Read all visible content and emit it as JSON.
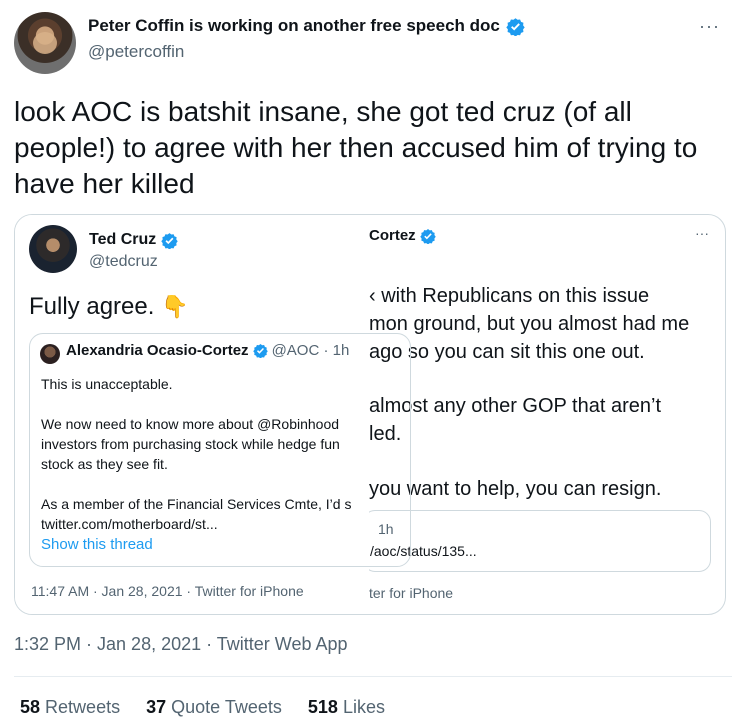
{
  "author": {
    "name": "Peter Coffin is working on another free speech doc",
    "handle": "@petercoffin",
    "more": "···"
  },
  "tweet": {
    "text": "look AOC is batshit insane, she got ted cruz (of all people!) to agree with her then accused him of trying to have her killed",
    "timestamp": "1:32 PM · Jan 28, 2021 · Twitter Web App"
  },
  "screenshot": {
    "cruz": {
      "name": "Ted Cruz",
      "handle": "@tedcruz",
      "text": "Fully agree.",
      "emoji": "👇",
      "time": "11:47 AM · Jan 28, 2021 · Twitter for iPhone"
    },
    "quoted": {
      "name": "Alexandria Ocasio-Cortez",
      "handle_time": "@AOC · 1h",
      "body": "This is unacceptable.\n\nWe now need to know more about @Robinhood\ninvestors from purchasing stock while hedge fun\nstock as they see fit.\n\nAs a member of the Financial Services Cmte, I’d s\ntwitter.com/motherboard/st...",
      "show_thread": "Show this thread"
    },
    "aoc_right": {
      "name_fragment": "Cortez",
      "dots": "···",
      "lines": [
        "‹ with Republicans on this issue",
        "mon ground, but you almost had me",
        "ago so you can sit this one out.",
        "almost any other GOP that aren’t",
        "led.",
        "you want to help, you can resign."
      ],
      "card_time": "1h",
      "card_link": "/aoc/status/135...",
      "footer": "ter for iPhone"
    }
  },
  "stats": {
    "retweets_count": "58",
    "retweets_label": "Retweets",
    "quotes_count": "37",
    "quotes_label": "Quote Tweets",
    "likes_count": "518",
    "likes_label": "Likes"
  },
  "colors": {
    "verified": "#1d9bf0",
    "secondary_text": "#536471",
    "link": "#1d9bf0"
  }
}
